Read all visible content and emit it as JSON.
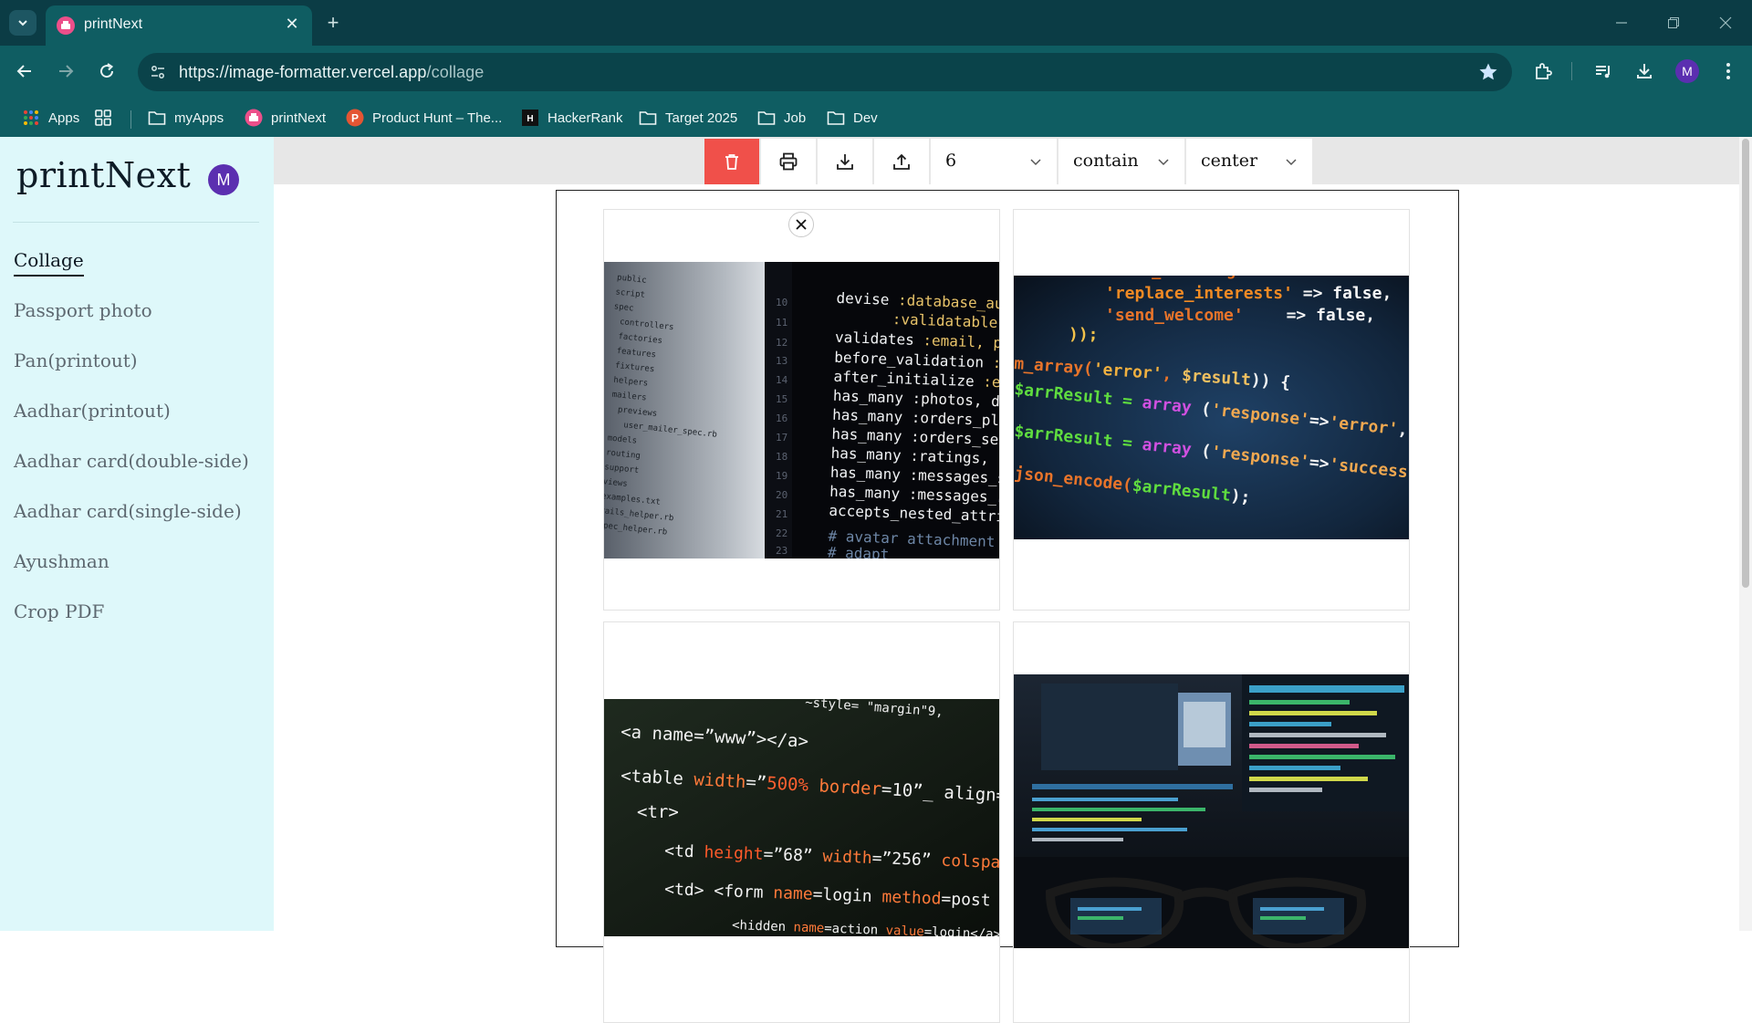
{
  "browser": {
    "tab": {
      "title": "printNext"
    },
    "address": {
      "host": "https://image-formatter.vercel.app",
      "path": "/collage"
    },
    "bookmarks": [
      {
        "label": "Apps",
        "icon": "apps-grid-icon"
      },
      {
        "label": "",
        "icon": "tab-groups-icon"
      },
      {
        "label": "myApps",
        "icon": "folder-icon"
      },
      {
        "label": "printNext",
        "icon": "printnext-favicon"
      },
      {
        "label": "Product Hunt – The...",
        "icon": "product-hunt-icon"
      },
      {
        "label": "HackerRank",
        "icon": "hackerrank-icon"
      },
      {
        "label": "Target 2025",
        "icon": "folder-icon"
      },
      {
        "label": "Job",
        "icon": "folder-icon"
      },
      {
        "label": "Dev",
        "icon": "folder-icon"
      }
    ],
    "profile_initial": "M"
  },
  "app": {
    "logo": "printNext",
    "avatar_initial": "M",
    "nav": [
      {
        "label": "Collage",
        "active": true
      },
      {
        "label": "Passport photo",
        "active": false
      },
      {
        "label": "Pan(printout)",
        "active": false
      },
      {
        "label": "Aadhar(printout)",
        "active": false
      },
      {
        "label": "Aadhar card(double-side)",
        "active": false
      },
      {
        "label": "Aadhar card(single-side)",
        "active": false
      },
      {
        "label": "Ayushman",
        "active": false
      },
      {
        "label": "Crop PDF",
        "active": false
      }
    ],
    "toolbar": {
      "buttons": [
        "delete-icon",
        "print-icon",
        "download-icon",
        "upload-icon"
      ],
      "count_value": "6",
      "fit_value": "contain",
      "position_value": "center"
    }
  },
  "colors": {
    "chrome_dark": "#0b3c45",
    "chrome": "#0f5d62",
    "sidebar": "#def8fa",
    "delete": "#f0504a",
    "accent_purple": "#5b2fb0"
  }
}
